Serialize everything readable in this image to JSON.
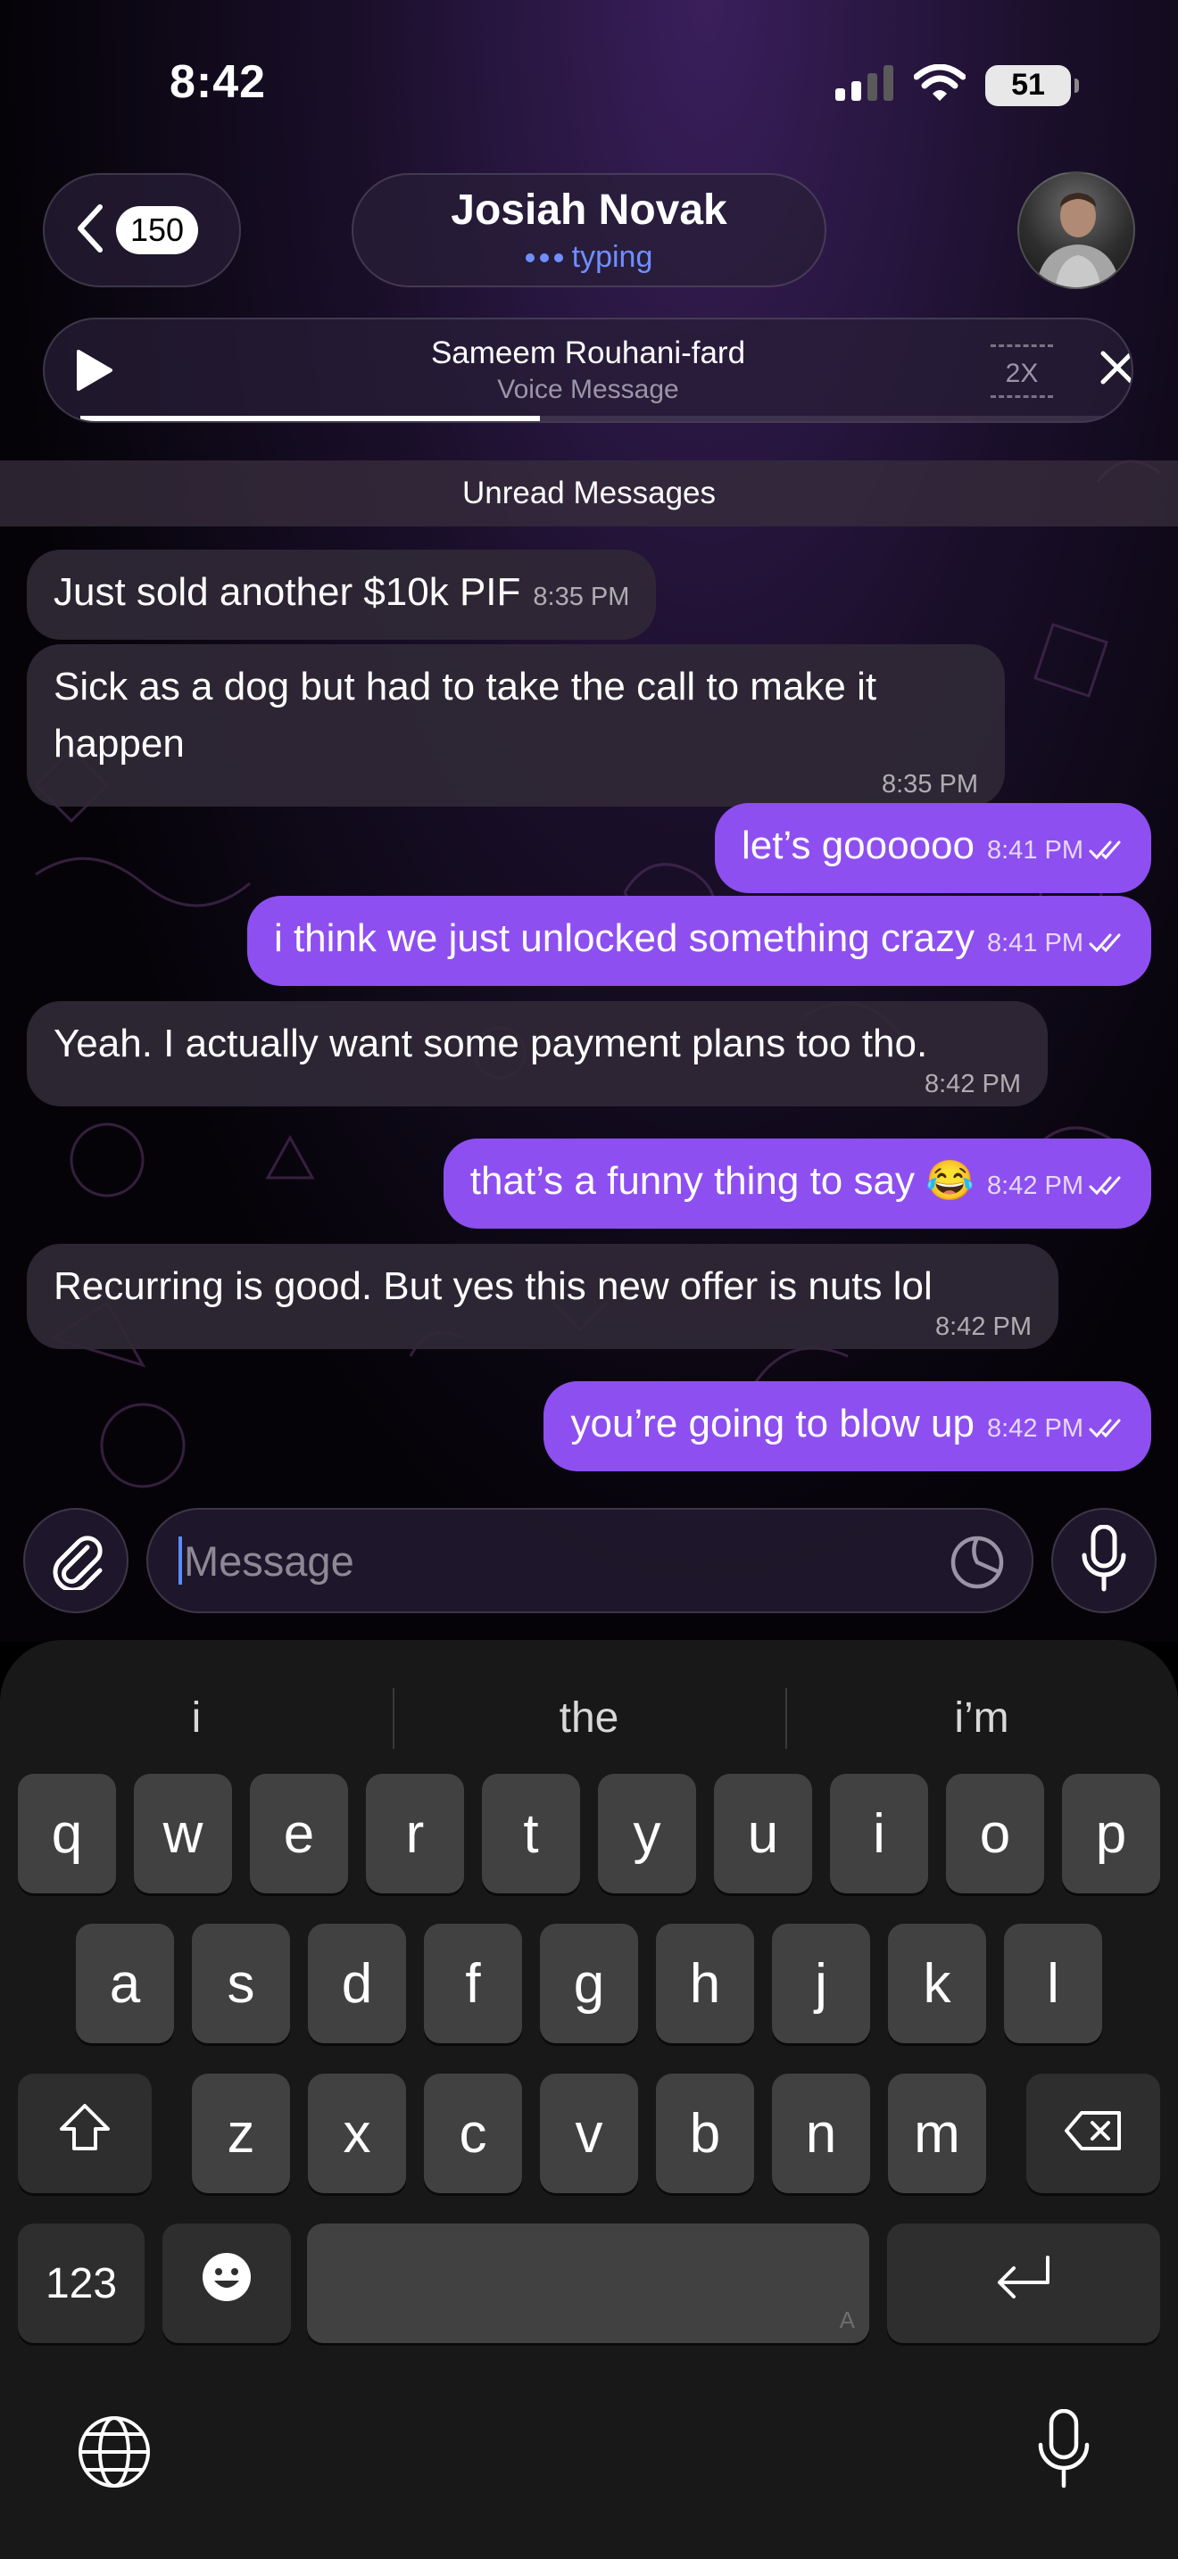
{
  "status_bar": {
    "time": "8:42",
    "battery": "51"
  },
  "header": {
    "back_count": "150",
    "contact_name": "Josiah Novak",
    "contact_status": "typing"
  },
  "voice_player": {
    "sender": "Sameem Rouhani-fard",
    "label": "Voice Message",
    "speed": "2X",
    "progress": 0.44
  },
  "unread_label": "Unread Messages",
  "messages": [
    {
      "direction": "in",
      "text": "Just sold another $10k PIF",
      "time": "8:35 PM"
    },
    {
      "direction": "in",
      "text": "Sick as a dog but had to take the call to make it happen",
      "time": "8:35 PM"
    },
    {
      "direction": "out",
      "text": "let’s goooooo",
      "time": "8:41 PM"
    },
    {
      "direction": "out",
      "text": "i think we just unlocked something crazy",
      "time": "8:41 PM"
    },
    {
      "direction": "in",
      "text": "Yeah. I actually want some payment plans too tho.",
      "time": "8:42 PM"
    },
    {
      "direction": "out",
      "text": "that’s a funny thing to say 😂",
      "time": "8:42 PM"
    },
    {
      "direction": "in",
      "text": "Recurring is good. But yes this new offer is nuts lol",
      "time": "8:42 PM"
    },
    {
      "direction": "out",
      "text": "you’re going to blow up",
      "time": "8:42 PM"
    }
  ],
  "composer": {
    "placeholder": "Message"
  },
  "keyboard": {
    "suggestions": [
      "i",
      "the",
      "i’m"
    ],
    "row1": [
      "q",
      "w",
      "e",
      "r",
      "t",
      "y",
      "u",
      "i",
      "o",
      "p"
    ],
    "row2": [
      "a",
      "s",
      "d",
      "f",
      "g",
      "h",
      "j",
      "k",
      "l"
    ],
    "row3": [
      "z",
      "x",
      "c",
      "v",
      "b",
      "n",
      "m"
    ],
    "numbers_key": "123",
    "space_hint": "A"
  },
  "colors": {
    "outgoing_bubble": "#8e4ff0",
    "incoming_bubble": "#302836",
    "accent_blue": "#6f8fff"
  }
}
